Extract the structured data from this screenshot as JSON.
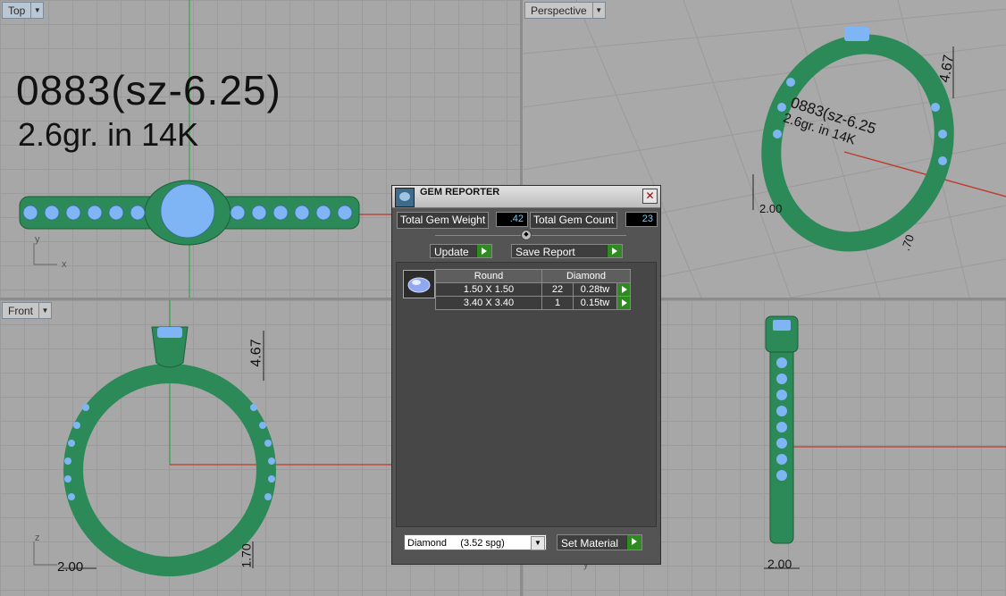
{
  "viewports": {
    "top": {
      "label": "Top",
      "text_line1": "0883(sz-6.25)",
      "text_line2": "2.6gr.  in 14K",
      "axis_y": "y",
      "axis_x": "x"
    },
    "perspective": {
      "label": "Perspective",
      "dim_height": "4.67",
      "dim_width": "2.00",
      "dim_bottom": ".70",
      "text_line1": "0883(sz-6.25",
      "text_line2": "2.6gr.  in 14K"
    },
    "front": {
      "label": "Front",
      "dim_height": "4.67",
      "dim_width": "2.00",
      "dim_bottom": "1.70",
      "axis_z": "z"
    },
    "right": {
      "dim_width": "2.00",
      "axis_y": "y"
    }
  },
  "gem_reporter": {
    "title": "GEM REPORTER",
    "total_weight_label": "Total Gem Weight",
    "total_weight_value": ".42",
    "total_count_label": "Total Gem Count",
    "total_count_value": "23",
    "update_label": "Update",
    "save_report_label": "Save Report",
    "table": {
      "headers": [
        "Round",
        "Diamond"
      ],
      "rows": [
        {
          "size": "1.50 X 1.50",
          "count": "22",
          "weight": "0.28tw"
        },
        {
          "size": "3.40 X 3.40",
          "count": "1",
          "weight": "0.15tw"
        }
      ]
    },
    "material_select": "Diamond     (3.52 spg)",
    "set_material_label": "Set Material"
  },
  "colors": {
    "ring_green": "#2b8a57",
    "gem_blue": "#7fb5f5",
    "axis_red": "#c0392b",
    "axis_green": "#2ea84a",
    "go_button": "#2f8a22"
  }
}
